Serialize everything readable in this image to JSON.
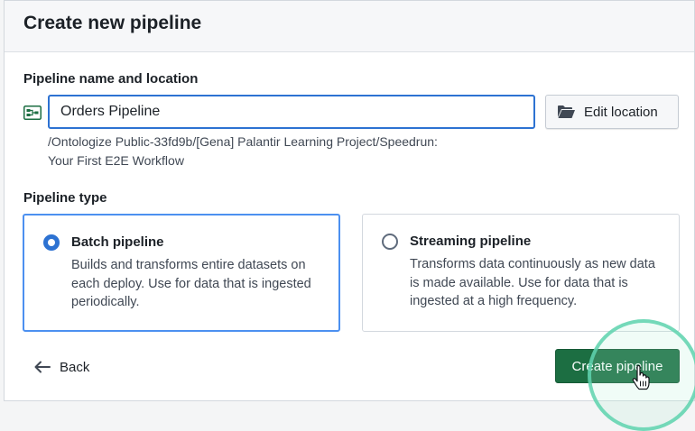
{
  "dialog": {
    "title": "Create new pipeline"
  },
  "name_section": {
    "label": "Pipeline name and location",
    "icon": "pipeline-icon",
    "name_value": "Orders Pipeline",
    "edit_location_label": "Edit location",
    "edit_location_icon": "folder-open-icon",
    "path_line1": "/Ontologize Public-33fd9b/[Gena] Palantir Learning Project/Speedrun:",
    "path_line2": "Your First E2E Workflow"
  },
  "type_section": {
    "label": "Pipeline type",
    "options": [
      {
        "title": "Batch pipeline",
        "description": "Builds and transforms entire datasets on each deploy. Use for data that is ingested periodically.",
        "selected": true
      },
      {
        "title": "Streaming pipeline",
        "description": "Transforms data continuously as new data is made available. Use for data that is ingested at a high frequency.",
        "selected": false
      }
    ]
  },
  "footer": {
    "back_label": "Back",
    "back_icon": "arrow-left-icon",
    "create_label": "Create pipeline"
  },
  "colors": {
    "accent_blue": "#2d72d2",
    "create_green": "#1c6e42",
    "click_highlight": "#5fd4af"
  }
}
